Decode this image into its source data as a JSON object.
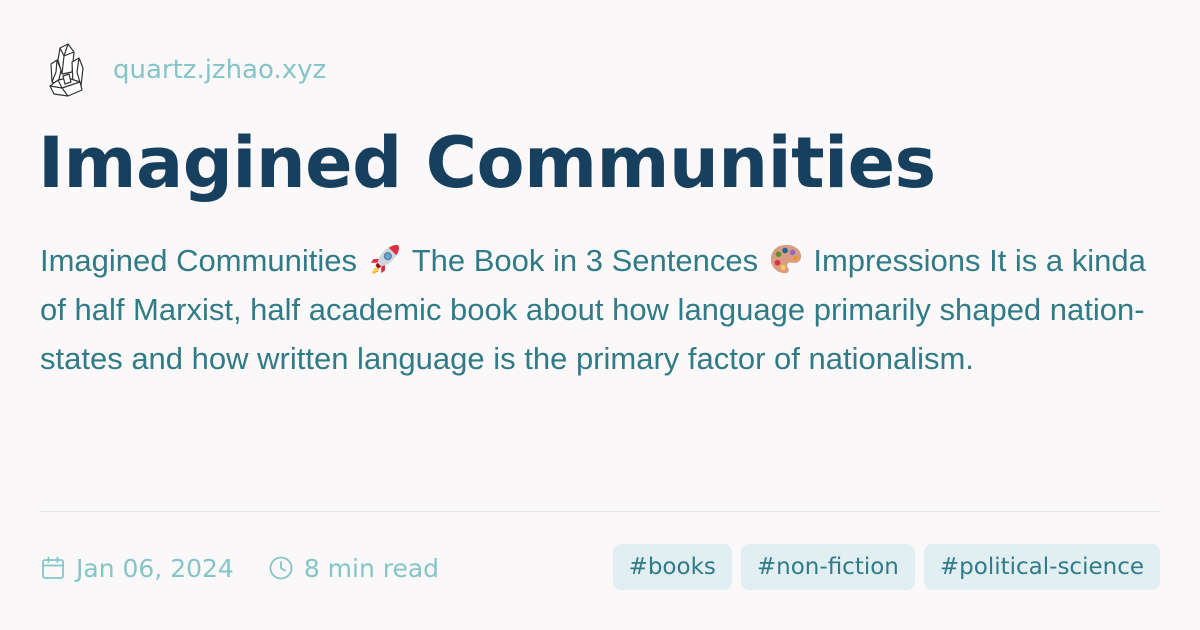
{
  "site": {
    "url": "quartz.jzhao.xyz",
    "logo_icon": "crystal-quartz-logo"
  },
  "article": {
    "title": "Imagined Communities",
    "description_parts": [
      "Imagined Communities",
      "The Book in 3 Sentences",
      "Impressions It is a kinda of half Marxist, half academic book about how language primarily shaped nation-states and how written language is the primary factor of nationalism."
    ],
    "emoji_icons": [
      "rocket-emoji",
      "artist-palette-emoji"
    ]
  },
  "meta": {
    "date": "Jan 06, 2024",
    "date_icon": "calendar-icon",
    "read_time": "8 min read",
    "read_time_icon": "clock-icon"
  },
  "tags": [
    "#books",
    "#non-fiction",
    "#political-science"
  ],
  "colors": {
    "background": "#faf8f8",
    "title": "#17405f",
    "description": "#317b87",
    "accent_light": "#84c5c7",
    "tag_background": "#e1eff3",
    "divider": "#e3e8ea"
  }
}
